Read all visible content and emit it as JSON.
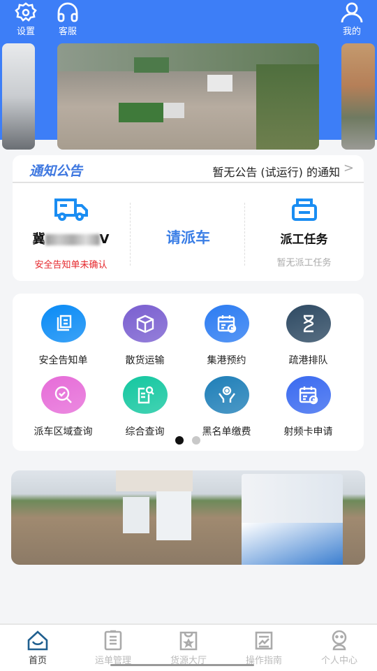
{
  "header": {
    "settings_label": "设置",
    "service_label": "客服",
    "mine_label": "我的",
    "color": "#3d7ef7"
  },
  "notice": {
    "title": "通知公告",
    "text": "暂无公告 (试运行) 的通知",
    "chevron": ">"
  },
  "dispatch": {
    "plate_prefix": "冀",
    "plate_suffix": "V",
    "vehicle_status": "安全告知单未确认",
    "request_label": "请派车",
    "task_title": "派工任务",
    "task_status": "暂无派工任务"
  },
  "grid": {
    "items": [
      {
        "label": "安全告知单",
        "icon": "document-icon",
        "color": "#0a8bf5"
      },
      {
        "label": "散货运输",
        "icon": "box-icon",
        "color": "#7a5fd0"
      },
      {
        "label": "集港预约",
        "icon": "calendar-clock-icon",
        "color": "#2c7cf2"
      },
      {
        "label": "疏港排队",
        "icon": "hourglass-icon",
        "color": "#2e4a63"
      },
      {
        "label": "派车区域查询",
        "icon": "search-check-icon",
        "color": "#e66cd8"
      },
      {
        "label": "综合查询",
        "icon": "doc-search-icon",
        "color": "#14c7a0"
      },
      {
        "label": "黑名单缴费",
        "icon": "hands-coin-icon",
        "color": "#1f7fb8"
      },
      {
        "label": "射频卡申请",
        "icon": "calendar-clock-icon",
        "color": "#3a6af0"
      }
    ],
    "page": 1,
    "pages": 2
  },
  "nav": {
    "items": [
      {
        "label": "首页",
        "icon": "home-icon",
        "active": true
      },
      {
        "label": "运单管理",
        "icon": "clipboard-icon"
      },
      {
        "label": "货源大厅",
        "icon": "bag-star-icon"
      },
      {
        "label": "操作指南",
        "icon": "chart-icon"
      },
      {
        "label": "个人中心",
        "icon": "person-icon"
      }
    ]
  }
}
